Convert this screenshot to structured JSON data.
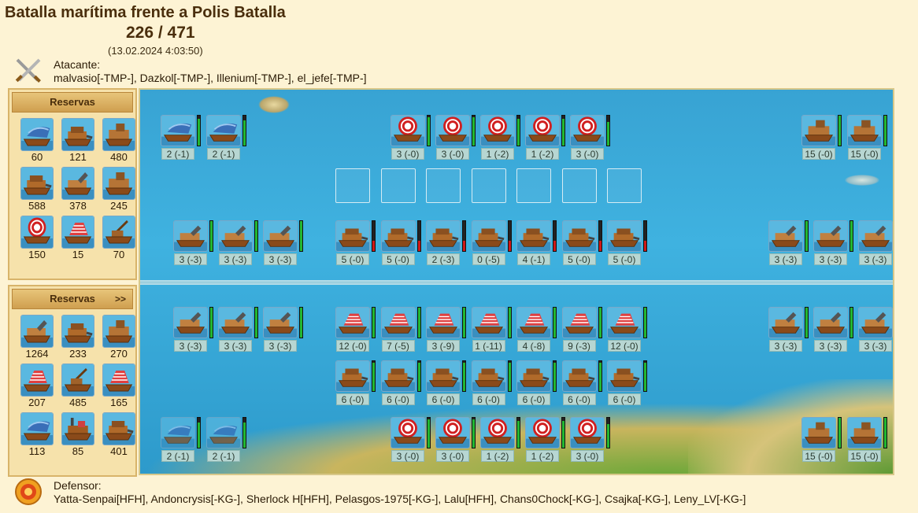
{
  "header": {
    "title": "Batalla marítima frente a Polis Batalla",
    "round": "226 / 471",
    "datetime": "(13.02.2024 4:03:50)"
  },
  "attacker": {
    "label": "Atacante:",
    "players": "malvasio[-TMP-], Dazkol[-TMP-], Illenium[-TMP-], el_jefe[-TMP-]",
    "icon": "crossed-swords-icon"
  },
  "defender": {
    "label": "Defensor:",
    "players": "Yatta-Senpai[HFH], Andoncrysis[-KG-], Sherlock H[HFH], Pelasgos-1975[-KG-], Lalu[HFH], Chans0Chock[-KG-], Csajka[-KG-], Leny_LV[-KG-]",
    "icon": "shield-target-icon"
  },
  "attacker_reserves": {
    "title": "Reservas",
    "units": [
      {
        "type": "flame-ship",
        "count": "60"
      },
      {
        "type": "ram-ship",
        "count": "121"
      },
      {
        "type": "ballista-ship",
        "count": "480"
      },
      {
        "type": "ram-ship",
        "count": "588"
      },
      {
        "type": "mortar-ship",
        "count": "378"
      },
      {
        "type": "ballista-ship",
        "count": "245"
      },
      {
        "type": "paddle-steamer",
        "count": "150"
      },
      {
        "type": "rocket-ship",
        "count": "15"
      },
      {
        "type": "catapult-ship",
        "count": "70"
      }
    ]
  },
  "defender_reserves": {
    "title": "Reservas",
    "more": ">>",
    "units": [
      {
        "type": "mortar-ship",
        "count": "1264"
      },
      {
        "type": "ram-ship",
        "count": "233"
      },
      {
        "type": "ballista-ship",
        "count": "270"
      },
      {
        "type": "rocket-ship",
        "count": "207"
      },
      {
        "type": "catapult-ship",
        "count": "485"
      },
      {
        "type": "rocket-ship",
        "count": "165"
      },
      {
        "type": "flame-ship",
        "count": "113"
      },
      {
        "type": "steam-ram",
        "count": "85"
      },
      {
        "type": "ram-ship",
        "count": "401"
      }
    ]
  },
  "battlefield": {
    "attacker_back": {
      "left": [
        {
          "type": "flame-ship",
          "label": "2 (-1)",
          "hp": 0.9
        },
        {
          "type": "flame-ship",
          "label": "2 (-1)",
          "hp": 0.85
        }
      ],
      "center": [
        {
          "type": "paddle-steamer",
          "label": "3 (-0)",
          "hp": 0.95
        },
        {
          "type": "paddle-steamer",
          "label": "3 (-0)",
          "hp": 0.95
        },
        {
          "type": "paddle-steamer",
          "label": "1 (-2)",
          "hp": 0.9
        },
        {
          "type": "paddle-steamer",
          "label": "1 (-2)",
          "hp": 0.9
        },
        {
          "type": "paddle-steamer",
          "label": "3 (-0)",
          "hp": 0.8
        }
      ],
      "right": [
        {
          "type": "ballista-ship",
          "label": "15 (-0)",
          "hp": 1.0
        },
        {
          "type": "ballista-ship",
          "label": "15 (-0)",
          "hp": 1.0
        }
      ]
    },
    "empty_slots": 7,
    "attacker_front": {
      "left": [
        {
          "type": "mortar-ship",
          "label": "3 (-3)",
          "hp": 1.0
        },
        {
          "type": "mortar-ship",
          "label": "3 (-3)",
          "hp": 1.0
        },
        {
          "type": "mortar-ship",
          "label": "3 (-3)",
          "hp": 1.0
        }
      ],
      "center": [
        {
          "type": "ram-ship",
          "label": "5 (-0)",
          "hp": 0.95,
          "low": true
        },
        {
          "type": "ram-ship",
          "label": "5 (-0)",
          "hp": 0.95,
          "low": true
        },
        {
          "type": "ram-ship",
          "label": "2 (-3)",
          "hp": 0.95,
          "low": true
        },
        {
          "type": "ram-ship",
          "label": "0 (-5)",
          "hp": 0.95,
          "low": true
        },
        {
          "type": "ram-ship",
          "label": "4 (-1)",
          "hp": 0.95,
          "low": true
        },
        {
          "type": "ram-ship",
          "label": "5 (-0)",
          "hp": 0.95,
          "low": true
        },
        {
          "type": "ram-ship",
          "label": "5 (-0)",
          "hp": 0.95,
          "low": true
        }
      ],
      "right": [
        {
          "type": "mortar-ship",
          "label": "3 (-3)",
          "hp": 1.0
        },
        {
          "type": "mortar-ship",
          "label": "3 (-3)",
          "hp": 1.0
        },
        {
          "type": "mortar-ship",
          "label": "3 (-3)",
          "hp": 1.0
        }
      ]
    },
    "defender_front": {
      "left": [
        {
          "type": "mortar-ship",
          "label": "3 (-3)",
          "hp": 1.0
        },
        {
          "type": "mortar-ship",
          "label": "3 (-3)",
          "hp": 1.0
        },
        {
          "type": "mortar-ship",
          "label": "3 (-3)",
          "hp": 1.0
        }
      ],
      "center": [
        {
          "type": "rocket-ship",
          "label": "12 (-0)",
          "hp": 1.0
        },
        {
          "type": "rocket-ship",
          "label": "7 (-5)",
          "hp": 1.0
        },
        {
          "type": "rocket-ship",
          "label": "3 (-9)",
          "hp": 1.0
        },
        {
          "type": "rocket-ship",
          "label": "1 (-11)",
          "hp": 1.0
        },
        {
          "type": "rocket-ship",
          "label": "4 (-8)",
          "hp": 1.0
        },
        {
          "type": "rocket-ship",
          "label": "9 (-3)",
          "hp": 1.0
        },
        {
          "type": "rocket-ship",
          "label": "12 (-0)",
          "hp": 1.0
        }
      ],
      "right": [
        {
          "type": "mortar-ship",
          "label": "3 (-3)",
          "hp": 1.0
        },
        {
          "type": "mortar-ship",
          "label": "3 (-3)",
          "hp": 1.0
        },
        {
          "type": "mortar-ship",
          "label": "3 (-3)",
          "hp": 1.0
        }
      ]
    },
    "defender_middle": [
      {
        "type": "ram-ship",
        "label": "6 (-0)",
        "hp": 0.95
      },
      {
        "type": "ram-ship",
        "label": "6 (-0)",
        "hp": 0.95
      },
      {
        "type": "ram-ship",
        "label": "6 (-0)",
        "hp": 0.95
      },
      {
        "type": "ram-ship",
        "label": "6 (-0)",
        "hp": 0.95
      },
      {
        "type": "ram-ship",
        "label": "6 (-0)",
        "hp": 0.95
      },
      {
        "type": "ram-ship",
        "label": "6 (-0)",
        "hp": 0.95
      },
      {
        "type": "ram-ship",
        "label": "6 (-0)",
        "hp": 0.95
      }
    ],
    "defender_back": {
      "left": [
        {
          "type": "flame-ship",
          "label": "2 (-1)",
          "hp": 0.85,
          "faded": true
        },
        {
          "type": "flame-ship",
          "label": "2 (-1)",
          "hp": 0.85,
          "faded": true
        }
      ],
      "center": [
        {
          "type": "paddle-steamer",
          "label": "3 (-0)",
          "hp": 0.95
        },
        {
          "type": "paddle-steamer",
          "label": "3 (-0)",
          "hp": 0.95
        },
        {
          "type": "paddle-steamer",
          "label": "1 (-2)",
          "hp": 0.9
        },
        {
          "type": "paddle-steamer",
          "label": "1 (-2)",
          "hp": 0.9
        },
        {
          "type": "paddle-steamer",
          "label": "3 (-0)",
          "hp": 0.8
        }
      ],
      "right": [
        {
          "type": "ballista-ship",
          "label": "15 (-0)",
          "hp": 1.0
        },
        {
          "type": "ballista-ship",
          "label": "15 (-0)",
          "hp": 1.0
        }
      ]
    }
  },
  "colors": {
    "hp_green": "#22b832",
    "hp_red": "#d01818",
    "sea": "#38a3d3",
    "panel": "#f6e2ab"
  }
}
